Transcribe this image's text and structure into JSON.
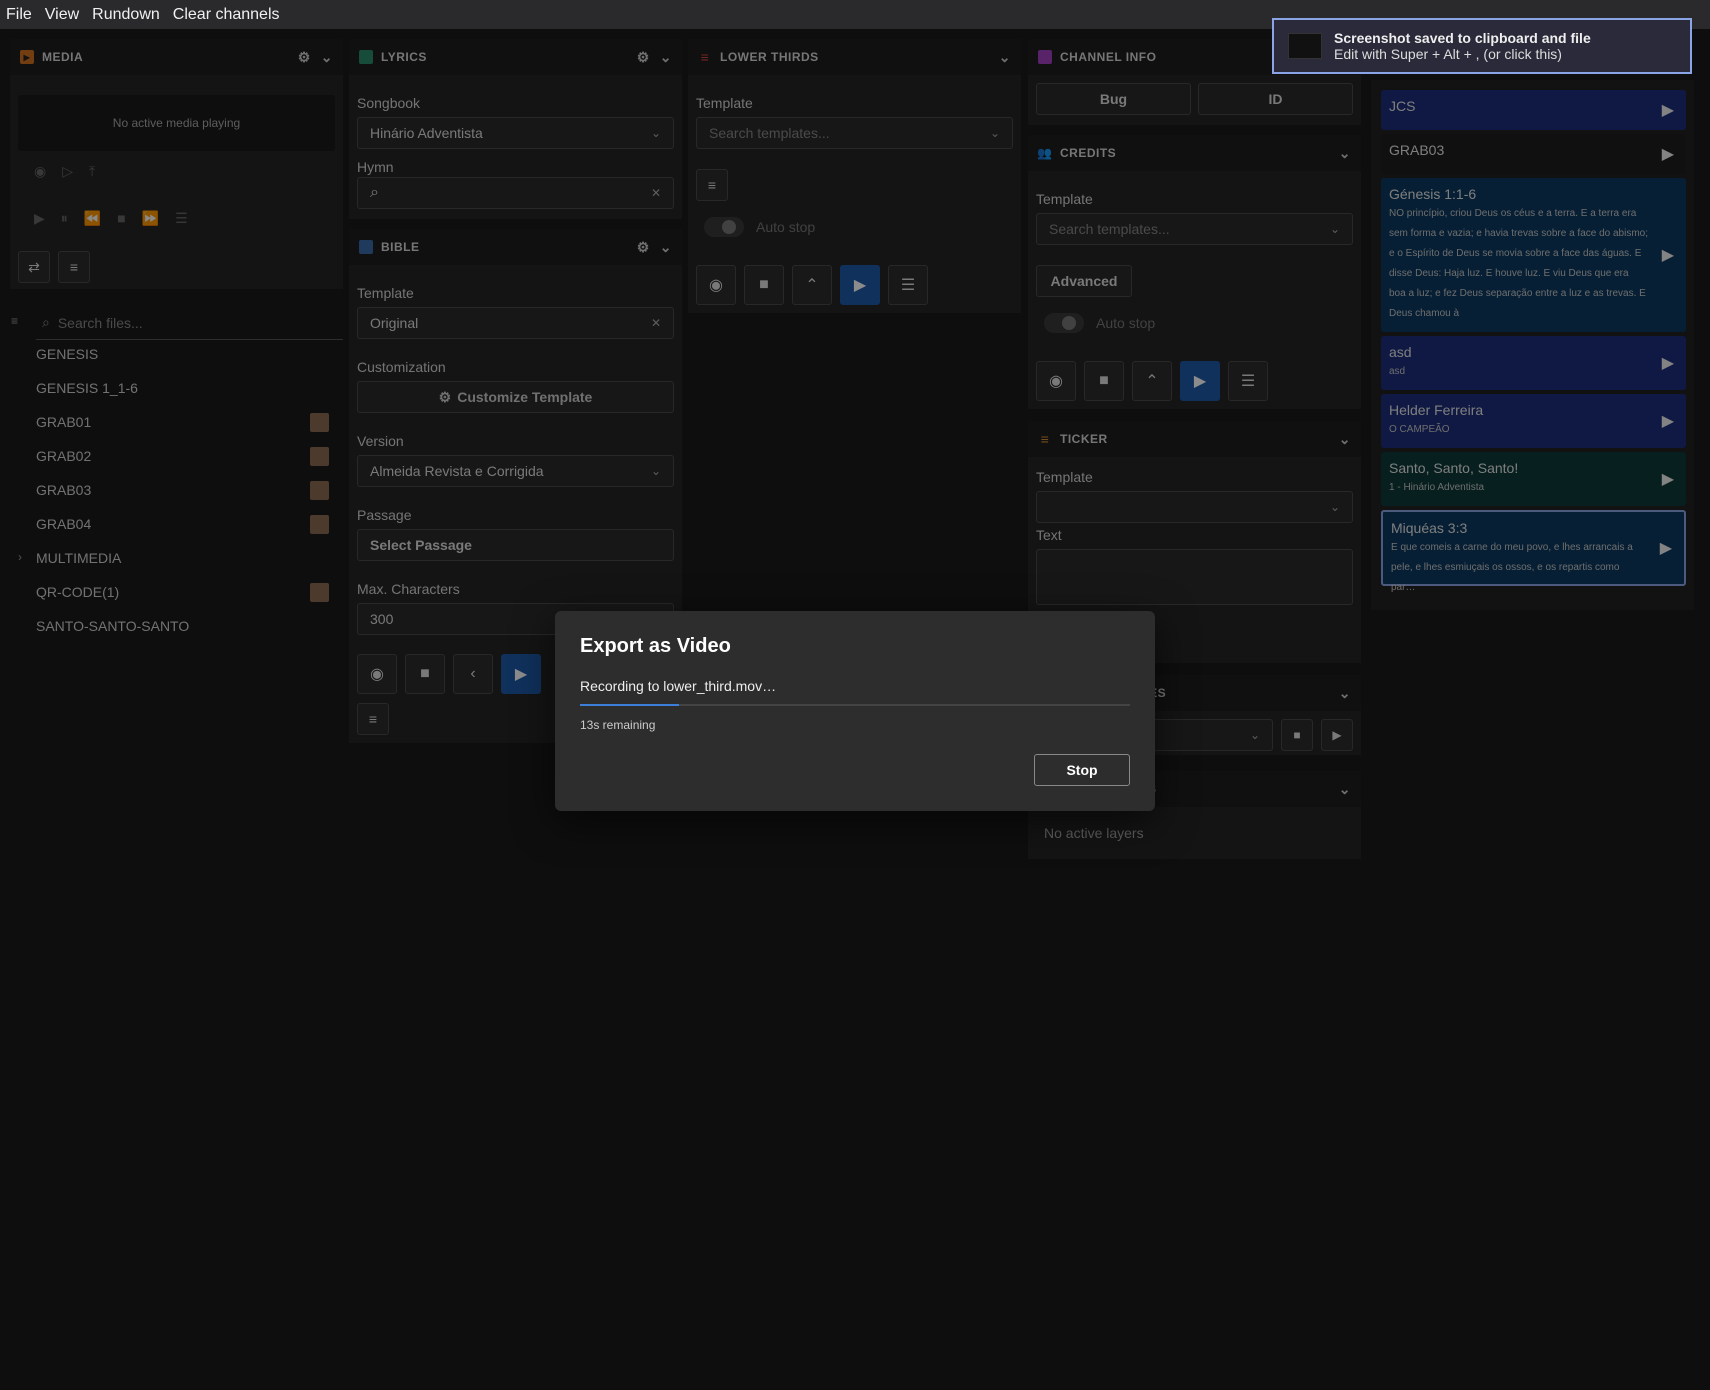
{
  "menu": [
    "File",
    "View",
    "Rundown",
    "Clear channels"
  ],
  "media": {
    "title": "MEDIA",
    "no_media": "No active media playing",
    "search_placeholder": "Search files...",
    "files": [
      {
        "name": "GENESIS",
        "thumb": false
      },
      {
        "name": "GENESIS 1_1-6",
        "thumb": false
      },
      {
        "name": "GRAB01",
        "thumb": true
      },
      {
        "name": "GRAB02",
        "thumb": true
      },
      {
        "name": "GRAB03",
        "thumb": true
      },
      {
        "name": "GRAB04",
        "thumb": true
      },
      {
        "name": "MULTIMEDIA",
        "thumb": false,
        "folder": true
      },
      {
        "name": "QR-CODE(1)",
        "thumb": true
      },
      {
        "name": "SANTO-SANTO-SANTO",
        "thumb": false
      }
    ]
  },
  "lyrics": {
    "title": "LYRICS",
    "songbook_label": "Songbook",
    "songbook_value": "Hinário Adventista",
    "hymn_label": "Hymn"
  },
  "bible": {
    "title": "BIBLE",
    "template_label": "Template",
    "template_value": "Original",
    "customization_label": "Customization",
    "customize_button": "Customize Template",
    "version_label": "Version",
    "version_value": "Almeida Revista e Corrigida",
    "passage_label": "Passage",
    "passage_button": "Select Passage",
    "maxchars_label": "Max. Characters",
    "maxchars_value": "300"
  },
  "lower_thirds": {
    "title": "LOWER THIRDS",
    "template_label": "Template",
    "template_placeholder": "Search templates...",
    "autostop_label": "Auto stop"
  },
  "channel_info": {
    "title": "CHANNEL INFO",
    "bug_button": "Bug",
    "id_button": "ID"
  },
  "credits": {
    "title": "CREDITS",
    "template_label": "Template",
    "template_placeholder": "Search templates...",
    "advanced_button": "Advanced",
    "autostop_label": "Auto stop"
  },
  "ticker": {
    "title": "TICKER",
    "template_label": "Template",
    "text_label": "Text"
  },
  "templates_partial": "ATES",
  "layers_partial": "S",
  "layers": {
    "no_layers": "No active layers"
  },
  "rundown": [
    {
      "title": "JCS",
      "sub": "",
      "color": "#1e2e7a"
    },
    {
      "title": "GRAB03",
      "sub": "",
      "color": "#1e1e1e"
    },
    {
      "title": "Génesis 1:1-6",
      "sub": "NO princípio, criou Deus os céus e a terra. E a terra era sem forma e vazia; e havia trevas sobre a face do abismo; e o Espírito de Deus se movia sobre a face das águas. E disse Deus: Haja luz. E houve luz. E viu Deus que era boa a luz; e fez Deus separação entre a luz e as trevas. E Deus chamou à",
      "color": "#0d3a60"
    },
    {
      "title": "asd",
      "sub": "asd",
      "color": "#1e2e7a"
    },
    {
      "title": "Helder Ferreira",
      "sub": "O CAMPEÃO",
      "color": "#1e2e7a"
    },
    {
      "title": "Santo, Santo, Santo!",
      "sub": "1 - Hinário Adventista",
      "color": "#0d3a3a"
    },
    {
      "title": "Miquéas 3:3",
      "sub": "E que comeis a carne do meu povo, e lhes arrancais a pele, e lhes esmiuçais os ossos, e os repartis como par…",
      "color": "#0d3a60"
    }
  ],
  "dialog": {
    "title": "Export as Video",
    "status": "Recording to lower_third.mov…",
    "remaining": "13s remaining",
    "stop_button": "Stop",
    "progress": 0.18
  },
  "toast": {
    "title": "Screenshot saved to clipboard and file",
    "subtitle": "Edit with Super + Alt + , (or click this)"
  },
  "colors": {
    "accent": "#1e5aa8",
    "progress": "#3b7fd9",
    "toast_border": "#8aa4e6"
  }
}
